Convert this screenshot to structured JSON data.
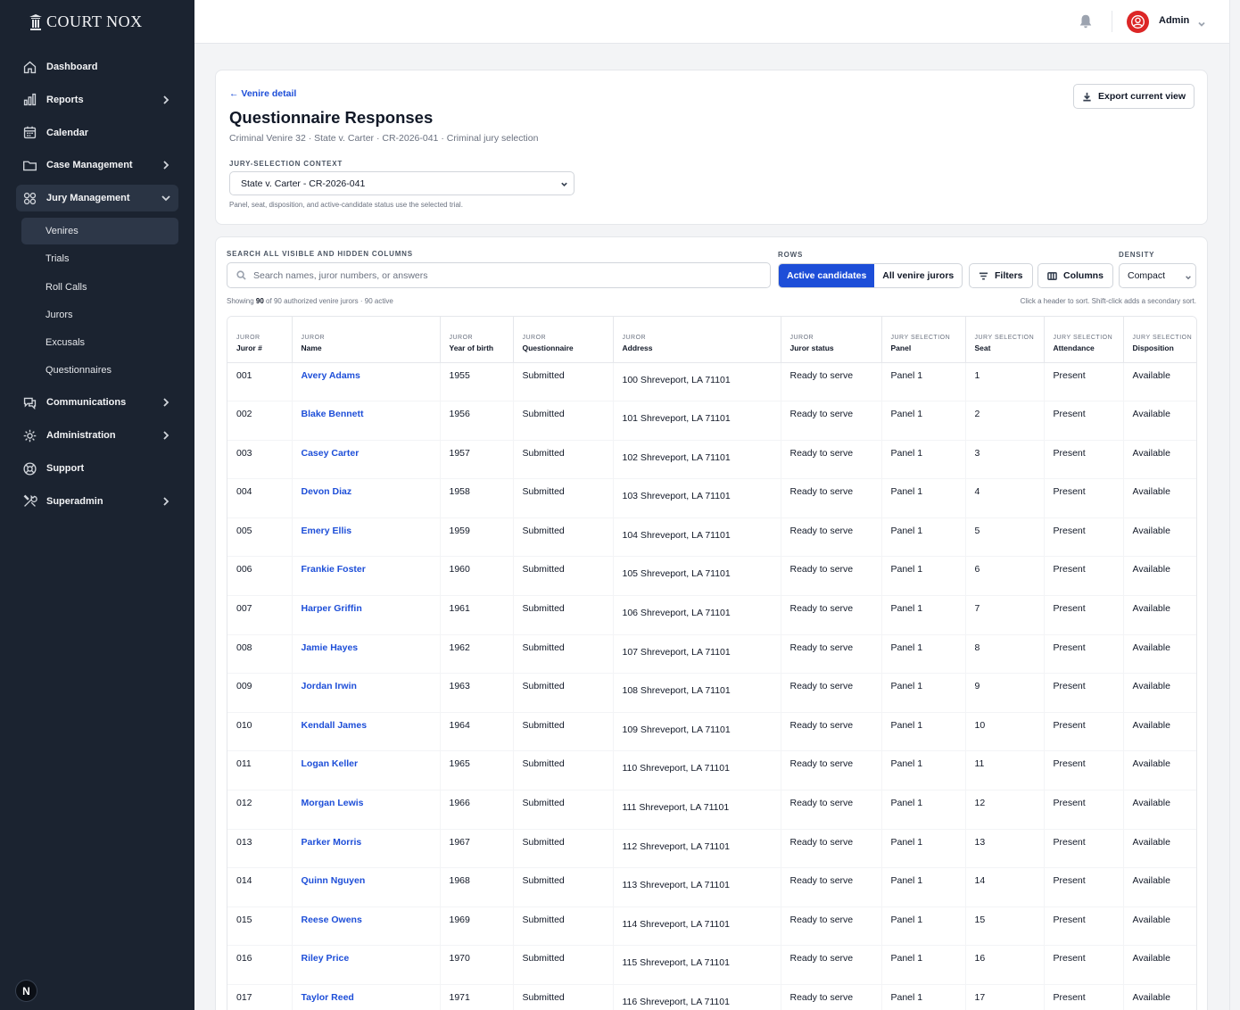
{
  "brand": {
    "name": "COURT NOX"
  },
  "sidebar": {
    "items": [
      {
        "label": "Dashboard",
        "icon": "home-icon",
        "chevron": false
      },
      {
        "label": "Reports",
        "icon": "bar-chart-icon",
        "chevron": true
      },
      {
        "label": "Calendar",
        "icon": "calendar-icon",
        "chevron": false
      },
      {
        "label": "Case Management",
        "icon": "folder-icon",
        "chevron": true
      },
      {
        "label": "Jury Management",
        "icon": "users-grid-icon",
        "chevron": true,
        "expanded": true
      }
    ],
    "subitems": [
      "Venires",
      "Trials",
      "Roll Calls",
      "Jurors",
      "Excusals",
      "Questionnaires"
    ],
    "items_after": [
      {
        "label": "Communications",
        "icon": "chat-icon",
        "chevron": true
      },
      {
        "label": "Administration",
        "icon": "gear-icon",
        "chevron": true
      },
      {
        "label": "Support",
        "icon": "lifebuoy-icon",
        "chevron": false
      },
      {
        "label": "Superadmin",
        "icon": "tools-icon",
        "chevron": true
      }
    ],
    "bottom_avatar": "N"
  },
  "topbar": {
    "user_name": "Admin"
  },
  "header": {
    "back_link": "← Venire detail",
    "title": "Questionnaire Responses",
    "subtitle": "Criminal Venire 32  ·  State v. Carter  ·  CR-2026-041  ·  Criminal jury selection",
    "context_label": "JURY-SELECTION CONTEXT",
    "context_value": "State v. Carter - CR-2026-041",
    "context_help": "Panel, seat, disposition, and active-candidate status use the selected trial.",
    "export_label": "Export current view"
  },
  "toolbar": {
    "search_label": "SEARCH ALL VISIBLE AND HIDDEN COLUMNS",
    "search_placeholder": "Search names, juror numbers, or answers",
    "search_value": "",
    "rows_label": "ROWS",
    "rows_active": "Active candidates",
    "rows_all": "All venire jurors",
    "filters_label": "Filters",
    "columns_label": "Columns",
    "density_label": "DENSITY",
    "density_value": "Compact",
    "showing_prefix": "Showing ",
    "showing_count": "90",
    "showing_suffix": " of 90 authorized venire jurors · 90 active",
    "sort_hint": "Click a header to sort. Shift-click adds a secondary sort."
  },
  "table": {
    "columns": [
      {
        "group": "JUROR",
        "name": "Juror #"
      },
      {
        "group": "JUROR",
        "name": "Name"
      },
      {
        "group": "JUROR",
        "name": "Year of birth"
      },
      {
        "group": "JUROR",
        "name": "Questionnaire"
      },
      {
        "group": "JUROR",
        "name": "Address"
      },
      {
        "group": "JUROR",
        "name": "Juror status"
      },
      {
        "group": "JURY SELECTION",
        "name": "Panel"
      },
      {
        "group": "JURY SELECTION",
        "name": "Seat"
      },
      {
        "group": "JURY SELECTION",
        "name": "Attendance"
      },
      {
        "group": "JURY SELECTION",
        "name": "Disposition"
      }
    ],
    "rows": [
      [
        "001",
        "Avery Adams",
        "1955",
        "Submitted",
        "100 Shreveport, LA 71101",
        "Ready to serve",
        "Panel 1",
        "1",
        "Present",
        "Available"
      ],
      [
        "002",
        "Blake Bennett",
        "1956",
        "Submitted",
        "101 Shreveport, LA 71101",
        "Ready to serve",
        "Panel 1",
        "2",
        "Present",
        "Available"
      ],
      [
        "003",
        "Casey Carter",
        "1957",
        "Submitted",
        "102 Shreveport, LA 71101",
        "Ready to serve",
        "Panel 1",
        "3",
        "Present",
        "Available"
      ],
      [
        "004",
        "Devon Diaz",
        "1958",
        "Submitted",
        "103 Shreveport, LA 71101",
        "Ready to serve",
        "Panel 1",
        "4",
        "Present",
        "Available"
      ],
      [
        "005",
        "Emery Ellis",
        "1959",
        "Submitted",
        "104 Shreveport, LA 71101",
        "Ready to serve",
        "Panel 1",
        "5",
        "Present",
        "Available"
      ],
      [
        "006",
        "Frankie Foster",
        "1960",
        "Submitted",
        "105 Shreveport, LA 71101",
        "Ready to serve",
        "Panel 1",
        "6",
        "Present",
        "Available"
      ],
      [
        "007",
        "Harper Griffin",
        "1961",
        "Submitted",
        "106 Shreveport, LA 71101",
        "Ready to serve",
        "Panel 1",
        "7",
        "Present",
        "Available"
      ],
      [
        "008",
        "Jamie Hayes",
        "1962",
        "Submitted",
        "107 Shreveport, LA 71101",
        "Ready to serve",
        "Panel 1",
        "8",
        "Present",
        "Available"
      ],
      [
        "009",
        "Jordan Irwin",
        "1963",
        "Submitted",
        "108 Shreveport, LA 71101",
        "Ready to serve",
        "Panel 1",
        "9",
        "Present",
        "Available"
      ],
      [
        "010",
        "Kendall James",
        "1964",
        "Submitted",
        "109 Shreveport, LA 71101",
        "Ready to serve",
        "Panel 1",
        "10",
        "Present",
        "Available"
      ],
      [
        "011",
        "Logan Keller",
        "1965",
        "Submitted",
        "110 Shreveport, LA 71101",
        "Ready to serve",
        "Panel 1",
        "11",
        "Present",
        "Available"
      ],
      [
        "012",
        "Morgan Lewis",
        "1966",
        "Submitted",
        "111 Shreveport, LA 71101",
        "Ready to serve",
        "Panel 1",
        "12",
        "Present",
        "Available"
      ],
      [
        "013",
        "Parker Morris",
        "1967",
        "Submitted",
        "112 Shreveport, LA 71101",
        "Ready to serve",
        "Panel 1",
        "13",
        "Present",
        "Available"
      ],
      [
        "014",
        "Quinn Nguyen",
        "1968",
        "Submitted",
        "113 Shreveport, LA 71101",
        "Ready to serve",
        "Panel 1",
        "14",
        "Present",
        "Available"
      ],
      [
        "015",
        "Reese Owens",
        "1969",
        "Submitted",
        "114 Shreveport, LA 71101",
        "Ready to serve",
        "Panel 1",
        "15",
        "Present",
        "Available"
      ],
      [
        "016",
        "Riley Price",
        "1970",
        "Submitted",
        "115 Shreveport, LA 71101",
        "Ready to serve",
        "Panel 1",
        "16",
        "Present",
        "Available"
      ],
      [
        "017",
        "Taylor Reed",
        "1971",
        "Submitted",
        "116 Shreveport, LA 71101",
        "Ready to serve",
        "Panel 1",
        "17",
        "Present",
        "Available"
      ]
    ]
  },
  "colors": {
    "sidebar_bg": "#1b2330",
    "accent": "#1d4ed8",
    "avatar_red": "#dc2626"
  }
}
